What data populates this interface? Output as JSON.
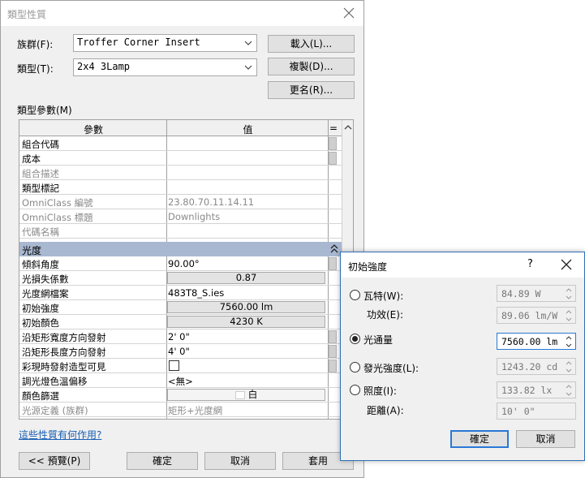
{
  "main": {
    "title": "類型性質",
    "family_label": "族群(F):",
    "family_value": "Troffer Corner Insert",
    "type_label": "類型(T):",
    "type_value": "2x4 3Lamp",
    "load_button": "載入(L)...",
    "duplicate_button": "複製(D)...",
    "rename_button": "更名(R)...",
    "type_params_label": "類型參數(M)",
    "col_param": "參數",
    "col_value": "值",
    "col_eq": "=",
    "rows_top": [
      {
        "name": "組合代碼",
        "value": ""
      },
      {
        "name": "成本",
        "value": ""
      },
      {
        "name": "組合描述",
        "value": ""
      },
      {
        "name": "類型標記",
        "value": ""
      },
      {
        "name": "OmniClass 編號",
        "value": "23.80.70.11.14.11"
      },
      {
        "name": "OmniClass 標題",
        "value": "Downlights"
      },
      {
        "name": "代碼名稱",
        "value": ""
      }
    ],
    "group_photometrics": "光度",
    "rows_photo": {
      "tilt_angle": {
        "name": "傾斜角度",
        "value": "90.00°"
      },
      "light_loss": {
        "name": "光損失係數",
        "value": "0.87"
      },
      "web_file": {
        "name": "光度網檔案",
        "value": "483T8_S.ies"
      },
      "initial_intensity": {
        "name": "初始強度",
        "value": "7560.00 lm"
      },
      "initial_color": {
        "name": "初始顏色",
        "value": "4230 K"
      },
      "emit_width": {
        "name": "沿矩形寬度方向發射",
        "value": "2'  0\""
      },
      "emit_length": {
        "name": "沿矩形長度方向發射",
        "value": "4'  0\""
      },
      "rendering_visible": {
        "name": "彩現時發射造型可見",
        "value": ""
      },
      "dimming": {
        "name": "調光燈色溫偏移",
        "value": "<無>"
      },
      "color_filter": {
        "name": "顏色篩選",
        "value": "白"
      },
      "source_def": {
        "name": "光源定義 (族群)",
        "value": "矩形+光度網"
      }
    },
    "help_link": "這些性質有何作用?",
    "preview_button": "<< 預覽(P)",
    "ok_button": "確定",
    "cancel_button": "取消",
    "apply_button": "套用"
  },
  "popup": {
    "title": "初始強度",
    "help": "?",
    "wattage_label": "瓦特(W):",
    "wattage_value": "84.89 W",
    "efficacy_label": "功效(E):",
    "efficacy_value": "89.06 lm/W",
    "flux_label": "光通量",
    "flux_value": "7560.00 lm",
    "intensity_label": "發光強度(L):",
    "intensity_value": "1243.20 cd",
    "illuminance_label": "照度(I):",
    "illuminance_value": "133.82 lx",
    "distance_label": "距離(A):",
    "distance_value": "10'  0\"",
    "ok_button": "確定",
    "cancel_button": "取消",
    "selected_option": "flux"
  }
}
